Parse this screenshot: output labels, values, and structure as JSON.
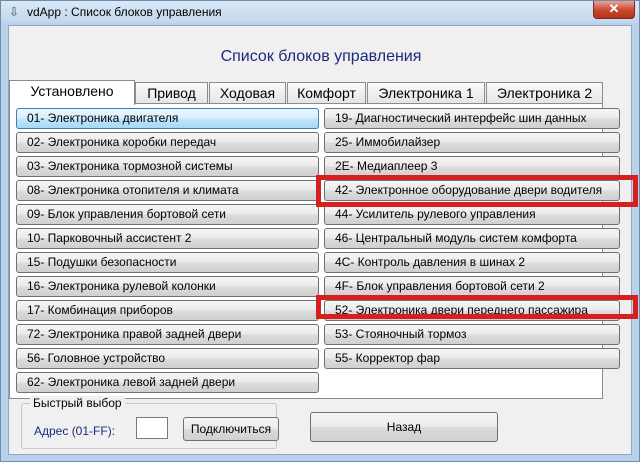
{
  "window": {
    "title": "vdApp :  Список блоков управления",
    "app_icon": "down-arrow-icon",
    "close_label": "✕"
  },
  "heading": "Список блоков управления",
  "tabs": [
    {
      "label": "Установлено",
      "active": true
    },
    {
      "label": "Привод",
      "active": false
    },
    {
      "label": "Ходовая",
      "active": false
    },
    {
      "label": "Комфорт",
      "active": false
    },
    {
      "label": "Электроника 1",
      "active": false
    },
    {
      "label": "Электроника 2",
      "active": false
    }
  ],
  "left_column": [
    "01- Электроника двигателя",
    "02- Электроника коробки передач",
    "03- Электроника тормозной системы",
    "08- Электроника отопителя и климата",
    "09- Блок управления бортовой сети",
    "10- Парковочный ассистент 2",
    "15- Подушки безопасности",
    "16- Электроника рулевой колонки",
    "17- Комбинация приборов",
    "72- Электроника правой задней двери",
    "56- Головное устройство",
    "62- Электроника левой задней двери"
  ],
  "right_column": [
    "19- Диагностический интерфейс шин данных",
    "25- Иммобилайзер",
    "2E- Медиаплеер 3",
    "42- Электронное оборудование двери водителя",
    "44- Усилитель рулевого управления",
    "46- Центральный модуль систем комфорта",
    "4C- Контроль давления в шинах 2",
    "4F- Блок управления бортовой сети 2",
    "52- Электроника двери переднего пассажира",
    "53- Стояночный тормоз",
    "55- Корректор фар"
  ],
  "quick_select": {
    "group_title": "Быстрый выбор",
    "address_label": "Адрес (01-FF):",
    "address_value": "",
    "connect_label": "Подключиться"
  },
  "back_label": "Назад",
  "highlight_color": "#d62020"
}
